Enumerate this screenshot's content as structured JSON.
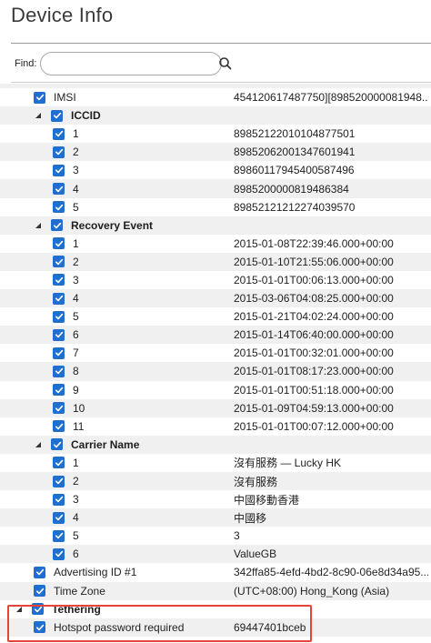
{
  "header": {
    "title": "Device Info"
  },
  "search": {
    "label": "Find:",
    "placeholder": ""
  },
  "tree": {
    "imsi": {
      "label": "IMSI",
      "value": "454120617487750][898520000081948..."
    },
    "iccid": {
      "label": "ICCID",
      "items": [
        {
          "label": "1",
          "value": "89852122010104877501"
        },
        {
          "label": "2",
          "value": "89852062001347601941"
        },
        {
          "label": "3",
          "value": "89860117945400587496"
        },
        {
          "label": "4",
          "value": "8985200000819486384"
        },
        {
          "label": "5",
          "value": "89852121212274039570"
        }
      ]
    },
    "recovery_event": {
      "label": "Recovery Event",
      "items": [
        {
          "label": "1",
          "value": "2015-01-08T22:39:46.000+00:00"
        },
        {
          "label": "2",
          "value": "2015-01-10T21:55:06.000+00:00"
        },
        {
          "label": "3",
          "value": "2015-01-01T00:06:13.000+00:00"
        },
        {
          "label": "4",
          "value": "2015-03-06T04:08:25.000+00:00"
        },
        {
          "label": "5",
          "value": "2015-01-21T04:02:24.000+00:00"
        },
        {
          "label": "6",
          "value": "2015-01-14T06:40:00.000+00:00"
        },
        {
          "label": "7",
          "value": "2015-01-01T00:32:01.000+00:00"
        },
        {
          "label": "8",
          "value": "2015-01-01T08:17:23.000+00:00"
        },
        {
          "label": "9",
          "value": "2015-01-01T00:51:18.000+00:00"
        },
        {
          "label": "10",
          "value": "2015-01-09T04:59:13.000+00:00"
        },
        {
          "label": "11",
          "value": "2015-01-01T00:07:12.000+00:00"
        }
      ]
    },
    "carrier_name": {
      "label": "Carrier Name",
      "items": [
        {
          "label": "1",
          "value": "沒有服務 — Lucky HK"
        },
        {
          "label": "2",
          "value": "沒有服務"
        },
        {
          "label": "3",
          "value": "中國移動香港"
        },
        {
          "label": "4",
          "value": "中國移"
        },
        {
          "label": "5",
          "value": "3"
        },
        {
          "label": "6",
          "value": "ValueGB"
        }
      ]
    },
    "advertising_id": {
      "label": "Advertising ID #1",
      "value": "342ffa85-4efd-4bd2-8c90-06e8d34a95..."
    },
    "time_zone": {
      "label": "Time Zone",
      "value": "(UTC+08:00)  Hong_Kong  (Asia)"
    },
    "tethering": {
      "label": "Tethering",
      "items": [
        {
          "label": "Hotspot password required",
          "value": "69447401bceb"
        }
      ]
    }
  },
  "colors": {
    "checkbox": "#1f6fd1",
    "highlight": "#e8433a",
    "alt_row": "#f0f0f0"
  }
}
